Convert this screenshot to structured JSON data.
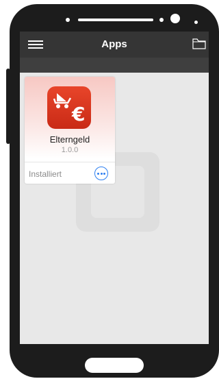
{
  "header": {
    "title": "Apps",
    "menu_icon": "hamburger-menu-icon",
    "folder_icon": "folder-icon"
  },
  "app_card": {
    "name": "Elterngeld",
    "version": "1.0.0",
    "status": "Installiert",
    "icon": "baby-stroller-euro-icon",
    "more_icon": "more-options-icon"
  },
  "colors": {
    "app_bar": "#3f3f3f",
    "screen_background": "#e8e8e8",
    "app_icon": "#d9351e",
    "accent": "#2d7ff0"
  }
}
